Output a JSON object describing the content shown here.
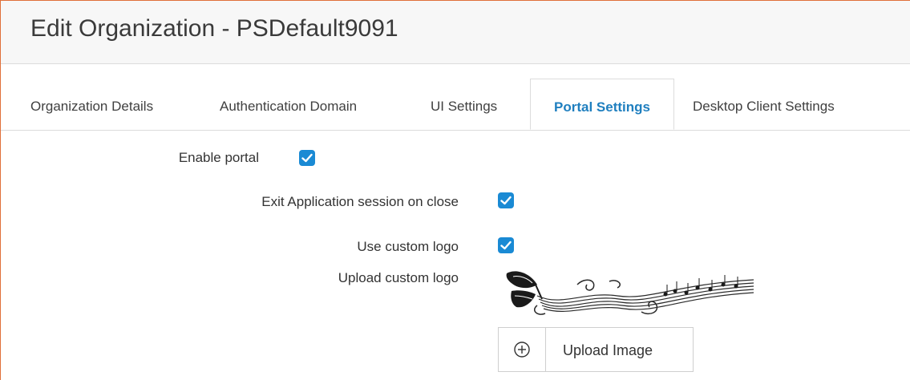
{
  "page": {
    "title": "Edit Organization - PSDefault9091"
  },
  "tabs": [
    {
      "label": "Organization Details",
      "active": false
    },
    {
      "label": "Authentication Domain",
      "active": false
    },
    {
      "label": "UI Settings",
      "active": false
    },
    {
      "label": "Portal Settings",
      "active": true
    },
    {
      "label": "Desktop Client Settings",
      "active": false
    }
  ],
  "portal_settings": {
    "enable_portal": {
      "label": "Enable portal",
      "checked": true
    },
    "exit_session": {
      "label": "Exit Application session on close",
      "checked": true
    },
    "custom_logo": {
      "label": "Use custom logo",
      "checked": true
    },
    "upload_logo": {
      "label": "Upload custom logo"
    },
    "upload_button": {
      "label": "Upload Image",
      "icon": "plus-circle-icon"
    }
  },
  "colors": {
    "accent": "#1a8ad4",
    "active_tab_text": "#1f7fbf",
    "frame_border": "#e0703a"
  }
}
